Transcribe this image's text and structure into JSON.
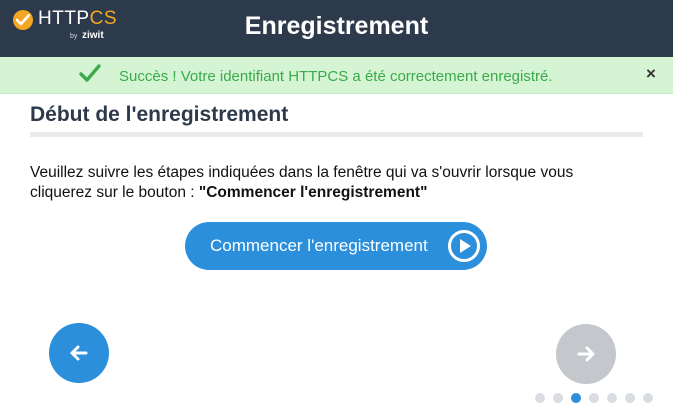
{
  "header": {
    "logo_main": "HTTP",
    "logo_accent": "CS",
    "logo_by": "by",
    "logo_brand": "ziwit",
    "title": "Enregistrement"
  },
  "alert": {
    "message": "Succès ! Votre identifiant HTTPCS a été correctement enregistré.",
    "close_label": "×",
    "icon": "check-icon",
    "color": "#3aaa4a"
  },
  "section": {
    "title": "Début de l'enregistrement"
  },
  "instructions": {
    "text": "Veuillez suivre les étapes indiquées dans la fenêtre qui va s'ouvrir lorsque vous cliquerez sur le bouton : ",
    "button_ref": "\"Commencer l'enregistrement\""
  },
  "start_button": {
    "label": "Commencer l'enregistrement",
    "icon": "play-circle-icon"
  },
  "navigation": {
    "prev_icon": "arrow-left-icon",
    "next_icon": "arrow-right-icon",
    "steps_total": 7,
    "current_step": 3
  },
  "colors": {
    "header_bg": "#2d3a4b",
    "accent": "#2b8fdc",
    "logo_accent": "#f5a623",
    "alert_bg": "#d4f4d4"
  }
}
